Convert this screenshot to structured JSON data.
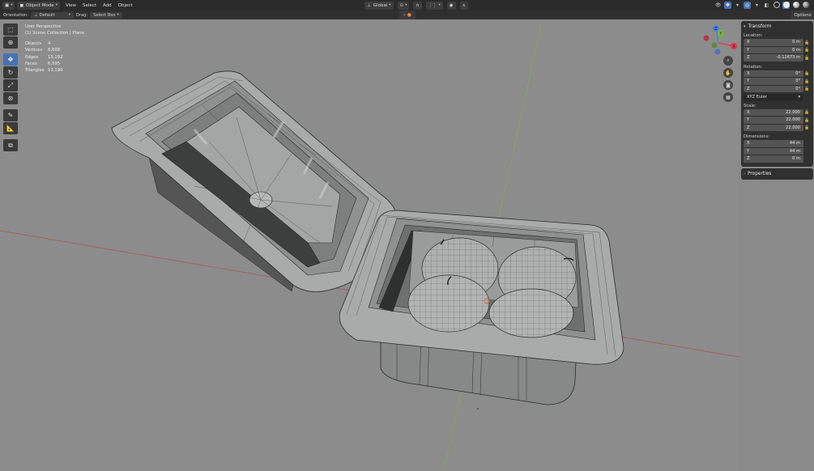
{
  "header": {
    "mode": "Object Mode",
    "menus": [
      "View",
      "Select",
      "Add",
      "Object"
    ],
    "transform_orientation": "Global"
  },
  "toolbar": {
    "orientation_label": "Orientation:",
    "orientation_value": "Default",
    "drag_label": "Drag:",
    "drag_value": "Select Box",
    "options_label": "Options"
  },
  "viewport": {
    "view_name": "User Perspective",
    "collection": "(1) Scene Collection | Plane",
    "stats": [
      {
        "label": "Objects",
        "value": "4"
      },
      {
        "label": "Vertices",
        "value": "6,608"
      },
      {
        "label": "Edges",
        "value": "13,192"
      },
      {
        "label": "Faces",
        "value": "6,595"
      },
      {
        "label": "Triangles",
        "value": "13,190"
      }
    ]
  },
  "gizmo": {
    "x": "X",
    "y": "Y",
    "z": "Z",
    "x_color": "#e2334a",
    "y_color": "#75b63a",
    "z_color": "#3d80e0"
  },
  "transform_panel": {
    "title": "Transform",
    "location_label": "Location:",
    "location": {
      "x": "0 m",
      "y": "0 m",
      "z": "-0.12673 m"
    },
    "rotation_label": "Rotation:",
    "rotation": {
      "x": "0°",
      "y": "0°",
      "z": "0°"
    },
    "rotation_mode": "XYZ Euler",
    "scale_label": "Scale:",
    "scale": {
      "x": "22.000",
      "y": "22.000",
      "z": "22.000"
    },
    "dimensions_label": "Dimensions:",
    "dimensions": {
      "x": "44 m",
      "y": "44 m",
      "z": "0 m"
    }
  },
  "properties_panel": {
    "title": "Properties"
  },
  "axis_labels": {
    "x": "X",
    "y": "Y",
    "z": "Z"
  },
  "colors": {
    "accent": "#4772b3",
    "viewport_bg": "#8c8c8c",
    "panel_bg": "#303030"
  }
}
